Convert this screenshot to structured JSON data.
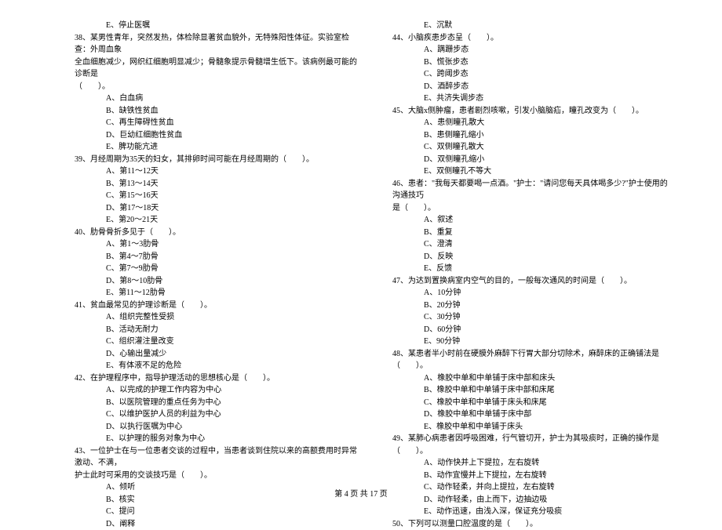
{
  "left": {
    "q37_e": "E、停止医嘱",
    "q38": "38、某男性青年，突然发热，体检除显著贫血貌外，无特殊阳性体征。实验室检查：外周血象",
    "q38_cont": "全血细胞减少，网织红细胞明显减少；骨髓象提示骨髓增生低下。该病例最可能的诊断是",
    "q38_blank": "（　　）。",
    "q38_a": "A、白血病",
    "q38_b": "B、缺铁性贫血",
    "q38_c": "C、再生障碍性贫血",
    "q38_d": "D、巨幼红细胞性贫血",
    "q38_e": "E、脾功能亢进",
    "q39": "39、月经周期为35天的妇女，其排卵时间可能在月经周期的（　　）。",
    "q39_a": "A、第11～12天",
    "q39_b": "B、第13～14天",
    "q39_c": "C、第15～16天",
    "q39_d": "D、第17～18天",
    "q39_e": "E、第20～21天",
    "q40": "40、肋骨骨折多见于（　　）。",
    "q40_a": "A、第1～3肋骨",
    "q40_b": "B、第4～7肋骨",
    "q40_c": "C、第7～9肋骨",
    "q40_d": "D、第8～10肋骨",
    "q40_e": "E、第11～12肋骨",
    "q41": "41、贫血最常见的护理诊断是（　　）。",
    "q41_a": "A、组织完整性受损",
    "q41_b": "B、活动无耐力",
    "q41_c": "C、组织灌注量改变",
    "q41_d": "D、心输出量减少",
    "q41_e": "E、有体液不足的危险",
    "q42": "42、在护理程序中，指导护理活动的思想核心是（　　）。",
    "q42_a": "A、以完成的护理工作内容为中心",
    "q42_b": "B、以医院管理的重点任务为中心",
    "q42_c": "C、以维护医护人员的利益为中心",
    "q42_d": "D、以执行医嘱为中心",
    "q42_e": "E、以护理的服务对象为中心",
    "q43": "43、一位护士在与一位患者交谈的过程中，当患者谈到住院以来的高额费用时异常激动、不满，",
    "q43_cont": "护士此时可采用的交谈技巧是（　　）。",
    "q43_a": "A、倾听",
    "q43_b": "B、核实",
    "q43_c": "C、提问",
    "q43_d": "D、阐释"
  },
  "right": {
    "q43_e": "E、沉默",
    "q44": "44、小脑疾患步态呈（　　）。",
    "q44_a": "A、蹒跚步态",
    "q44_b": "B、慌张步态",
    "q44_c": "C、跨阈步态",
    "q44_d": "D、酒醉步态",
    "q44_e": "E、共济失调步态",
    "q45": "45、大脑x侧肿瘤，患者剧烈咳嗽，引发小脑脑疝，瞳孔改变为（　　）。",
    "q45_a": "A、患侧瞳孔散大",
    "q45_b": "B、患侧瞳孔缩小",
    "q45_c": "C、双侧瞳孔散大",
    "q45_d": "D、双侧瞳孔缩小",
    "q45_e": "E、双侧瞳孔不等大",
    "q46": "46、患者：\"我每天都要喝一点酒。\"护士：\"请问您每天具体喝多少?\"护士使用的沟通技巧",
    "q46_cont": "是（　　）。",
    "q46_a": "A、叙述",
    "q46_b": "B、重复",
    "q46_c": "C、澄清",
    "q46_d": "D、反映",
    "q46_e": "E、反馈",
    "q47": "47、为达到置换病室内空气的目的，一般每次通风的时间是（　　）。",
    "q47_a": "A、10分钟",
    "q47_b": "B、20分钟",
    "q47_c": "C、30分钟",
    "q47_d": "D、60分钟",
    "q47_e": "E、90分钟",
    "q48": "48、某患者半小时前在硬膜外麻醉下行胃大部分切除术，麻醉床的正确铺法是（　　）。",
    "q48_a": "A、橡胶中单和中单铺于床中部和床头",
    "q48_b": "B、橡胶中单和中单铺于床中部和床尾",
    "q48_c": "C、橡胶中单和中单铺于床头和床尾",
    "q48_d": "D、橡胶中单和中单铺于床中部",
    "q48_e": "E、橡胶中单和中单铺于床头",
    "q49": "49、某肺心病患者因呼吸困难，行气管切开，护士为其吸痰时，正确的操作是（　　）。",
    "q49_a": "A、动作快并上下提拉，左右旋转",
    "q49_b": "B、动作宜慢并上下提拉，左右旋转",
    "q49_c": "C、动作轻柔，并向上提拉，左右旋转",
    "q49_d": "D、动作轻柔，由上而下，边抽边吸",
    "q49_e": "E、动作迅速，由浅入深，保证充分吸痰",
    "q50": "50、下列可以测量口腔温度的是（　　）。"
  },
  "footer": "第 4 页 共 17 页"
}
